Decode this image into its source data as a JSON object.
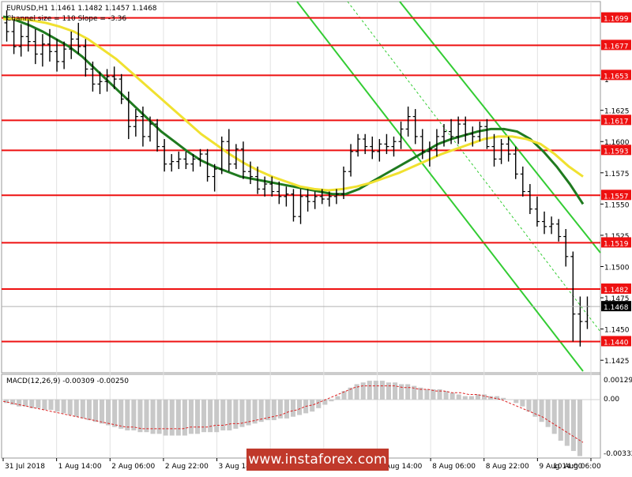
{
  "header": {
    "symbol_line": "EURUSD,H1  1.1461 1.1482 1.1457 1.1468",
    "channel_line": "Channel size = 110 Slope = -3.36"
  },
  "macd": {
    "label": "MACD(12,26,9) -0.00309 -0.00250",
    "top_label": "0.00129",
    "zero_label": "0.00",
    "bottom_label": "-0.00332",
    "ylim": [
      -0.00332,
      0.00129
    ],
    "histogram": [
      -0.0002,
      -0.0003,
      -0.0004,
      -0.0004,
      -0.0005,
      -0.0005,
      -0.0006,
      -0.0006,
      -0.0007,
      -0.0008,
      -0.0009,
      -0.001,
      -0.0011,
      -0.0012,
      -0.0013,
      -0.0014,
      -0.0015,
      -0.0016,
      -0.0017,
      -0.0018,
      -0.0018,
      -0.0019,
      -0.0019,
      -0.002,
      -0.002,
      -0.0021,
      -0.0021,
      -0.0021,
      -0.0021,
      -0.002,
      -0.002,
      -0.0019,
      -0.0019,
      -0.0019,
      -0.0018,
      -0.0018,
      -0.0017,
      -0.0016,
      -0.0015,
      -0.0014,
      -0.0013,
      -0.0012,
      -0.0012,
      -0.0011,
      -0.0011,
      -0.001,
      -0.0009,
      -0.0008,
      -0.0007,
      -0.0005,
      -0.0003,
      -0.0001,
      0.0002,
      0.0005,
      0.0007,
      0.0009,
      0.001,
      0.0011,
      0.0011,
      0.0011,
      0.001,
      0.001,
      0.0009,
      0.0009,
      0.0008,
      0.0007,
      0.0006,
      0.0006,
      0.0006,
      0.0005,
      0.0004,
      0.0003,
      0.0002,
      0.0002,
      0.0003,
      0.0003,
      0.0002,
      0.0002,
      0.0001,
      0.0,
      -0.0002,
      -0.0004,
      -0.0007,
      -0.001,
      -0.0013,
      -0.0016,
      -0.002,
      -0.0024,
      -0.0027,
      -0.003,
      -0.0033
    ],
    "signal": [
      -0.0001,
      -0.0002,
      -0.0003,
      -0.0004,
      -0.0005,
      -0.0006,
      -0.0007,
      -0.0008,
      -0.0009,
      -0.001,
      -0.0011,
      -0.0012,
      -0.0013,
      -0.0014,
      -0.0015,
      -0.0016,
      -0.0016,
      -0.0017,
      -0.0017,
      -0.0017,
      -0.0017,
      -0.0017,
      -0.0017,
      -0.0016,
      -0.0016,
      -0.0016,
      -0.0015,
      -0.0015,
      -0.0014,
      -0.0014,
      -0.0013,
      -0.0012,
      -0.0011,
      -0.001,
      -0.0009,
      -0.0007,
      -0.0006,
      -0.0004,
      -0.0003,
      -0.0001,
      0.0001,
      0.0003,
      0.0005,
      0.0007,
      0.0008,
      0.0008,
      0.0008,
      0.0008,
      0.0008,
      0.0007,
      0.0007,
      0.0006,
      0.0006,
      0.0005,
      0.0005,
      0.0004,
      0.0004,
      0.0003,
      0.0003,
      0.0002,
      0.0001,
      0.0,
      -0.0002,
      -0.0004,
      -0.0006,
      -0.0008,
      -0.001,
      -0.0013,
      -0.0016,
      -0.0019,
      -0.0022,
      -0.0025
    ]
  },
  "chart_data": {
    "type": "candlestick",
    "symbol": "EURUSD",
    "timeframe": "H1",
    "ylim": [
      1.1415,
      1.1712
    ],
    "y_ticks": [
      1.1425,
      1.145,
      1.1475,
      1.15,
      1.1525,
      1.155,
      1.1575,
      1.16,
      1.1625,
      1.165,
      1.1675,
      1.17
    ],
    "y_tick_labels": [
      "1.1425",
      "1.1450",
      "1.1475",
      "1.1500",
      "1.1525",
      "1.1550",
      "1.1575",
      "1.1600",
      "1.1625",
      "1",
      "",
      ""
    ],
    "x_tick_labels": [
      "31 Jul 2018",
      "1 Aug 14:00",
      "2 Aug 06:00",
      "2 Aug 22:00",
      "3 Aug 14:00",
      "6 Aug 06:00",
      "6 Aug 22:00",
      "7 Aug 14:00",
      "8 Aug 06:00",
      "8 Aug 22:00",
      "9 Aug 14:00",
      "10 Aug 06:00"
    ],
    "current_price": 1.1468,
    "current_price_label": "1.1468",
    "level_label_hidden": "1.1471",
    "levels": [
      {
        "value": 1.1699,
        "label": "1.1699"
      },
      {
        "value": 1.1677,
        "label": "1.1677"
      },
      {
        "value": 1.1653,
        "label": "1.1653"
      },
      {
        "value": 1.1617,
        "label": "1.1617"
      },
      {
        "value": 1.1593,
        "label": "1.1593"
      },
      {
        "value": 1.1557,
        "label": "1.1557"
      },
      {
        "value": 1.1519,
        "label": "1.1519"
      },
      {
        "value": 1.1482,
        "label": "1.1482"
      },
      {
        "value": 1.144,
        "label": "1.1440"
      }
    ],
    "candles": [
      [
        1.1695,
        1.1705,
        1.168,
        1.1688
      ],
      [
        1.1688,
        1.1698,
        1.167,
        1.1676
      ],
      [
        1.1676,
        1.1694,
        1.1668,
        1.1684
      ],
      [
        1.1684,
        1.1697,
        1.1672,
        1.168
      ],
      [
        1.168,
        1.169,
        1.1662,
        1.167
      ],
      [
        1.167,
        1.1686,
        1.166,
        1.1678
      ],
      [
        1.1678,
        1.169,
        1.1664,
        1.1672
      ],
      [
        1.1672,
        1.1682,
        1.1656,
        1.1664
      ],
      [
        1.1664,
        1.168,
        1.1658,
        1.1674
      ],
      [
        1.1674,
        1.1688,
        1.1666,
        1.1682
      ],
      [
        1.1682,
        1.1695,
        1.167,
        1.1676
      ],
      [
        1.1676,
        1.1682,
        1.1652,
        1.1658
      ],
      [
        1.1658,
        1.1664,
        1.164,
        1.1646
      ],
      [
        1.1646,
        1.1656,
        1.1638,
        1.1648
      ],
      [
        1.1648,
        1.1658,
        1.164,
        1.1652
      ],
      [
        1.1652,
        1.166,
        1.1642,
        1.165
      ],
      [
        1.165,
        1.1654,
        1.163,
        1.1634
      ],
      [
        1.1634,
        1.164,
        1.1602,
        1.1612
      ],
      [
        1.1612,
        1.1626,
        1.1604,
        1.162
      ],
      [
        1.162,
        1.1628,
        1.1596,
        1.1604
      ],
      [
        1.1604,
        1.162,
        1.16,
        1.1614
      ],
      [
        1.1614,
        1.1618,
        1.1592,
        1.1596
      ],
      [
        1.1596,
        1.1602,
        1.1576,
        1.1582
      ],
      [
        1.1582,
        1.159,
        1.1576,
        1.1584
      ],
      [
        1.1584,
        1.1592,
        1.1578,
        1.1586
      ],
      [
        1.1586,
        1.1592,
        1.1578,
        1.1582
      ],
      [
        1.1582,
        1.159,
        1.1576,
        1.1586
      ],
      [
        1.1586,
        1.1594,
        1.158,
        1.159
      ],
      [
        1.159,
        1.1594,
        1.1568,
        1.1572
      ],
      [
        1.1572,
        1.1582,
        1.156,
        1.1578
      ],
      [
        1.1578,
        1.1604,
        1.1574,
        1.16
      ],
      [
        1.16,
        1.161,
        1.1576,
        1.1582
      ],
      [
        1.1582,
        1.1598,
        1.1578,
        1.1594
      ],
      [
        1.1594,
        1.16,
        1.157,
        1.1576
      ],
      [
        1.1576,
        1.1584,
        1.1566,
        1.1572
      ],
      [
        1.1572,
        1.158,
        1.1558,
        1.1562
      ],
      [
        1.1562,
        1.1572,
        1.1556,
        1.1566
      ],
      [
        1.1566,
        1.1572,
        1.1556,
        1.156
      ],
      [
        1.156,
        1.1568,
        1.155,
        1.1556
      ],
      [
        1.1556,
        1.1564,
        1.1548,
        1.1558
      ],
      [
        1.1558,
        1.1562,
        1.1536,
        1.154
      ],
      [
        1.154,
        1.1562,
        1.1534,
        1.1556
      ],
      [
        1.1556,
        1.1562,
        1.1544,
        1.1552
      ],
      [
        1.1552,
        1.156,
        1.1546,
        1.1556
      ],
      [
        1.1556,
        1.1562,
        1.155,
        1.1554
      ],
      [
        1.1554,
        1.156,
        1.1548,
        1.1556
      ],
      [
        1.1556,
        1.1562,
        1.155,
        1.1558
      ],
      [
        1.1558,
        1.158,
        1.1554,
        1.1576
      ],
      [
        1.1576,
        1.1598,
        1.1572,
        1.1592
      ],
      [
        1.1592,
        1.1606,
        1.1588,
        1.1602
      ],
      [
        1.1602,
        1.1606,
        1.159,
        1.1596
      ],
      [
        1.1596,
        1.1604,
        1.1586,
        1.1592
      ],
      [
        1.1592,
        1.1602,
        1.1584,
        1.1598
      ],
      [
        1.1598,
        1.1606,
        1.159,
        1.1596
      ],
      [
        1.1596,
        1.1604,
        1.1588,
        1.16
      ],
      [
        1.16,
        1.1616,
        1.1594,
        1.161
      ],
      [
        1.161,
        1.1628,
        1.1604,
        1.162
      ],
      [
        1.162,
        1.1626,
        1.1598,
        1.1604
      ],
      [
        1.1604,
        1.161,
        1.1586,
        1.1592
      ],
      [
        1.1592,
        1.16,
        1.158,
        1.1594
      ],
      [
        1.1594,
        1.161,
        1.1588,
        1.1604
      ],
      [
        1.1604,
        1.1614,
        1.1596,
        1.1608
      ],
      [
        1.1608,
        1.1618,
        1.1598,
        1.1604
      ],
      [
        1.1604,
        1.162,
        1.1598,
        1.1614
      ],
      [
        1.1614,
        1.162,
        1.16,
        1.1606
      ],
      [
        1.1606,
        1.1612,
        1.1596,
        1.1604
      ],
      [
        1.1604,
        1.1616,
        1.16,
        1.1612
      ],
      [
        1.1612,
        1.1618,
        1.1594,
        1.1596
      ],
      [
        1.1596,
        1.1606,
        1.158,
        1.1586
      ],
      [
        1.1586,
        1.1602,
        1.1582,
        1.1598
      ],
      [
        1.1598,
        1.1604,
        1.1584,
        1.159
      ],
      [
        1.159,
        1.1596,
        1.157,
        1.1574
      ],
      [
        1.1574,
        1.158,
        1.1556,
        1.156
      ],
      [
        1.156,
        1.1566,
        1.1542,
        1.1546
      ],
      [
        1.1546,
        1.1556,
        1.1532,
        1.1536
      ],
      [
        1.1536,
        1.1544,
        1.1526,
        1.1532
      ],
      [
        1.1532,
        1.154,
        1.1526,
        1.1534
      ],
      [
        1.1534,
        1.1538,
        1.152,
        1.1524
      ],
      [
        1.1524,
        1.153,
        1.15,
        1.1508
      ],
      [
        1.1508,
        1.1512,
        1.144,
        1.1462
      ],
      [
        1.1462,
        1.1476,
        1.1436,
        1.1456
      ],
      [
        1.1456,
        1.1476,
        1.145,
        1.1468
      ]
    ],
    "series": [
      {
        "name": "",
        "color": "#1f7a1f",
        "values": [
          1.17,
          1.1697,
          1.1693,
          1.1688,
          1.1682,
          1.1676,
          1.1668,
          1.1658,
          1.1648,
          1.1638,
          1.1628,
          1.1618,
          1.1608,
          1.16,
          1.1592,
          1.1585,
          1.158,
          1.1576,
          1.1572,
          1.157,
          1.1568,
          1.1566,
          1.1564,
          1.1562,
          1.156,
          1.1558,
          1.1558,
          1.1562,
          1.1568,
          1.1574,
          1.158,
          1.1586,
          1.1592,
          1.1598,
          1.1602,
          1.1605,
          1.1608,
          1.161,
          1.161,
          1.1608,
          1.1602,
          1.1592,
          1.158,
          1.1566,
          1.155
        ]
      },
      {
        "name": "",
        "color": "#f0e130",
        "values": [
          1.1698,
          1.1698,
          1.1697,
          1.1695,
          1.1692,
          1.1688,
          1.1682,
          1.1674,
          1.1666,
          1.1656,
          1.1646,
          1.1636,
          1.1626,
          1.1616,
          1.1606,
          1.1598,
          1.159,
          1.1583,
          1.1577,
          1.1572,
          1.1568,
          1.1564,
          1.1562,
          1.1561,
          1.1562,
          1.1564,
          1.1567,
          1.1571,
          1.1575,
          1.158,
          1.1585,
          1.159,
          1.1594,
          1.1598,
          1.1602,
          1.1604,
          1.1604,
          1.1602,
          1.1598,
          1.159,
          1.158,
          1.1572
        ]
      }
    ]
  }
}
